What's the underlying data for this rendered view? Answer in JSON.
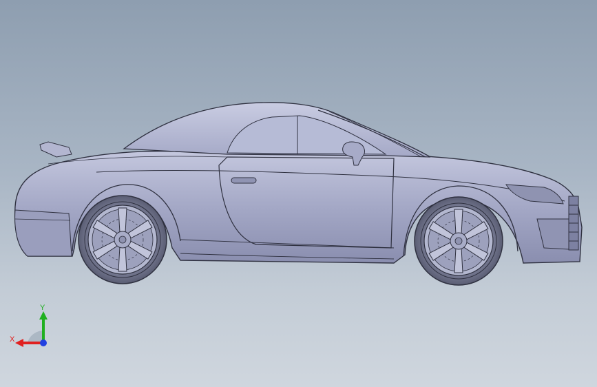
{
  "viewport": {
    "model": "sports-coupe-side-view",
    "colors": {
      "body": "#a9adc9",
      "body_shadow": "#7f84a6",
      "body_light": "#c8cbe0",
      "edge": "#2f3140",
      "glass": "#b6bbd6",
      "tire": "#5d6077",
      "rim": "#b3b7cf"
    }
  },
  "triad": {
    "x_label": "X",
    "y_label": "Y",
    "colors": {
      "x": "#e02020",
      "y": "#20b020",
      "z": "#2040e0"
    }
  }
}
